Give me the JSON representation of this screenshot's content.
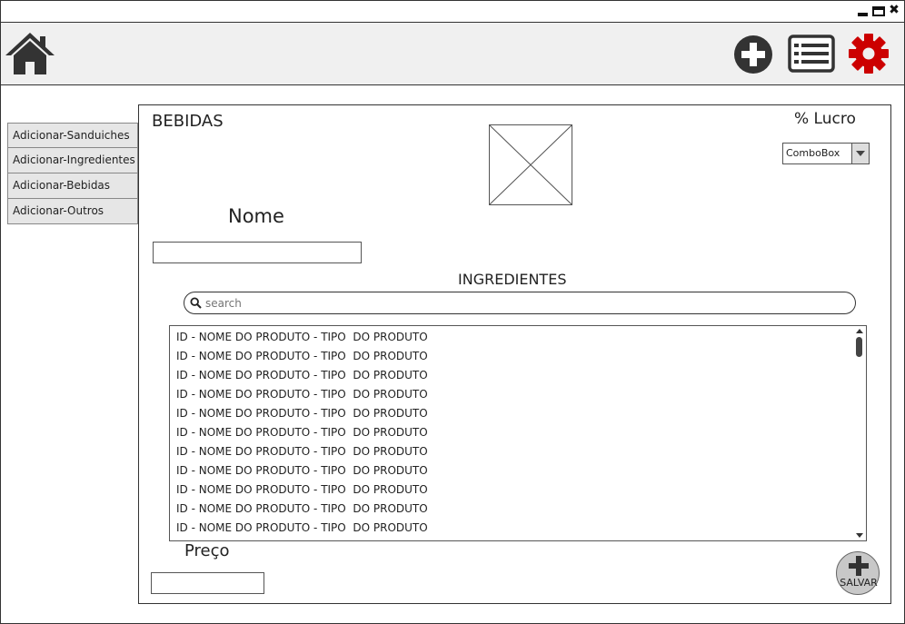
{
  "window": {
    "controls": {
      "minimize": "minimize-icon",
      "maximize": "maximize-icon",
      "close": "close-icon",
      "close_glyph": "✖"
    }
  },
  "toolbar": {
    "home_icon": "home-icon",
    "add_icon": "plus-circle-icon",
    "list_icon": "list-icon",
    "settings_icon": "gear-icon",
    "settings_color": "#cc0000"
  },
  "sidebar": {
    "items": [
      {
        "label": "Adicionar-Sanduiches"
      },
      {
        "label": "Adicionar-Ingredientes"
      },
      {
        "label": "Adicionar-Bebidas"
      },
      {
        "label": "Adicionar-Outros"
      }
    ]
  },
  "form": {
    "title": "BEBIDAS",
    "image_placeholder": "image-placeholder-icon",
    "lucro_label": "% Lucro",
    "combo_value": "ComboBox",
    "nome_label": "Nome",
    "nome_value": "",
    "ingredientes_label": "INGREDIENTES",
    "search_placeholder": "search",
    "list_items": [
      "ID - NOME DO PRODUTO - TIPO  DO PRODUTO",
      "ID - NOME DO PRODUTO - TIPO  DO PRODUTO",
      "ID - NOME DO PRODUTO - TIPO  DO PRODUTO",
      "ID - NOME DO PRODUTO - TIPO  DO PRODUTO",
      "ID - NOME DO PRODUTO - TIPO  DO PRODUTO",
      "ID - NOME DO PRODUTO - TIPO  DO PRODUTO",
      "ID - NOME DO PRODUTO - TIPO  DO PRODUTO",
      "ID - NOME DO PRODUTO - TIPO  DO PRODUTO",
      "ID - NOME DO PRODUTO - TIPO  DO PRODUTO",
      "ID - NOME DO PRODUTO - TIPO  DO PRODUTO",
      "ID - NOME DO PRODUTO - TIPO  DO PRODUTO"
    ],
    "preco_label": "Preço",
    "preco_value": "",
    "save_label": "SALVAR"
  }
}
